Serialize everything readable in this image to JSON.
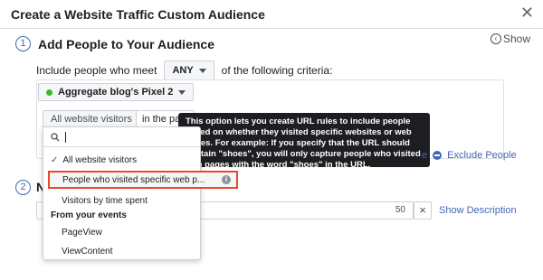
{
  "dialog": {
    "title": "Create a Website Traffic Custom Audience",
    "close_icon": "close-icon"
  },
  "show_toggle": {
    "label": "Show",
    "icon": "chevron-left-icon"
  },
  "step1": {
    "number": "1",
    "title": "Add People to Your Audience",
    "criteria_prefix": "Include people who meet",
    "match_value": "ANY",
    "criteria_suffix": "of the following criteria:",
    "pixel_label": "Aggregate blog's Pixel 2",
    "rule_value": "All website visitors",
    "in_past_label": "in the past"
  },
  "tooltip": {
    "text": "This option lets you create URL rules to include people based on whether they visited specific websites or web pages. For example: If you specify that the URL should contain \"shoes\", you will only capture people who visited web pages with the word \"shoes\" in the URL."
  },
  "actions": {
    "truncated_include": "e",
    "exclude_label": "Exclude People"
  },
  "dropdown": {
    "search_placeholder": "",
    "items": [
      {
        "label": "All website visitors",
        "checked": true
      },
      {
        "label": "People who visited specific web p...",
        "highlighted": true
      },
      {
        "label": "Visitors by time spent"
      }
    ],
    "group_label": "From your events",
    "event_items": [
      {
        "label": "PageView"
      },
      {
        "label": "ViewContent"
      }
    ]
  },
  "step2": {
    "number": "2",
    "title_partial": "N",
    "name_value": "N",
    "char_count": "50",
    "clear_label": "×",
    "show_description": "Show Description"
  }
}
